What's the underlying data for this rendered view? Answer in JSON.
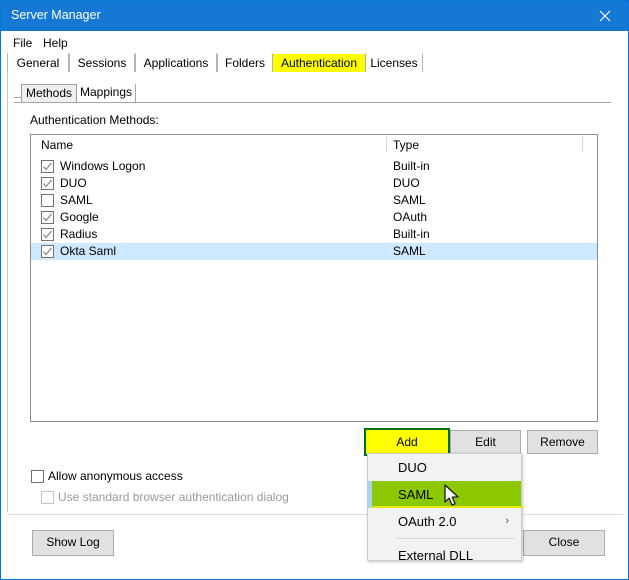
{
  "window": {
    "title": "Server Manager",
    "close_icon": "close-icon"
  },
  "menubar": {
    "items": [
      {
        "label": "File"
      },
      {
        "label": "Help"
      }
    ]
  },
  "tabs": {
    "items": [
      {
        "label": "General",
        "selected": false,
        "highlighted": false
      },
      {
        "label": "Sessions",
        "selected": false,
        "highlighted": false
      },
      {
        "label": "Applications",
        "selected": false,
        "highlighted": false
      },
      {
        "label": "Folders",
        "selected": false,
        "highlighted": false
      },
      {
        "label": "Authentication",
        "selected": true,
        "highlighted": true
      },
      {
        "label": "Licenses",
        "selected": false,
        "highlighted": false
      }
    ],
    "highlight_color": "#ffff00"
  },
  "inner_tabs": {
    "items": [
      {
        "label": "Methods",
        "selected": true
      },
      {
        "label": "Mappings",
        "selected": false
      }
    ]
  },
  "methods_panel": {
    "label": "Authentication Methods:",
    "columns": [
      {
        "key": "name",
        "label": "Name"
      },
      {
        "key": "type",
        "label": "Type"
      }
    ],
    "rows": [
      {
        "name": "Windows Logon",
        "type": "Built-in",
        "checked": true,
        "selected": false
      },
      {
        "name": "DUO",
        "type": "DUO",
        "checked": true,
        "selected": false
      },
      {
        "name": "SAML",
        "type": "SAML",
        "checked": false,
        "selected": false
      },
      {
        "name": "Google",
        "type": "OAuth",
        "checked": true,
        "selected": false
      },
      {
        "name": "Radius",
        "type": "Built-in",
        "checked": true,
        "selected": false
      },
      {
        "name": "Okta Saml",
        "type": "SAML",
        "checked": true,
        "selected": true
      }
    ],
    "selection_color": "#cde8ff"
  },
  "action_buttons": {
    "add": "Add",
    "edit": "Edit",
    "remove": "Remove",
    "add_highlight_fill": "#ffff00",
    "add_highlight_border": "#006b22"
  },
  "options": {
    "allow_anonymous": {
      "label": "Allow anonymous access",
      "checked": false,
      "enabled": true
    },
    "standard_browser_dialog": {
      "label": "Use standard browser authentication dialog",
      "checked": false,
      "enabled": false
    }
  },
  "footer": {
    "show_log": "Show Log",
    "close": "Close"
  },
  "context_menu": {
    "items": [
      {
        "label": "DUO",
        "active": false,
        "submenu": false
      },
      {
        "label": "SAML",
        "active": true,
        "submenu": false
      },
      {
        "label": "OAuth 2.0",
        "active": false,
        "submenu": true,
        "submenu_glyph": "›"
      },
      {
        "label": "External DLL",
        "active": false,
        "submenu": false
      }
    ],
    "highlight_color": "#8cc800"
  },
  "cursor": {
    "icon": "mouse-pointer-icon"
  }
}
